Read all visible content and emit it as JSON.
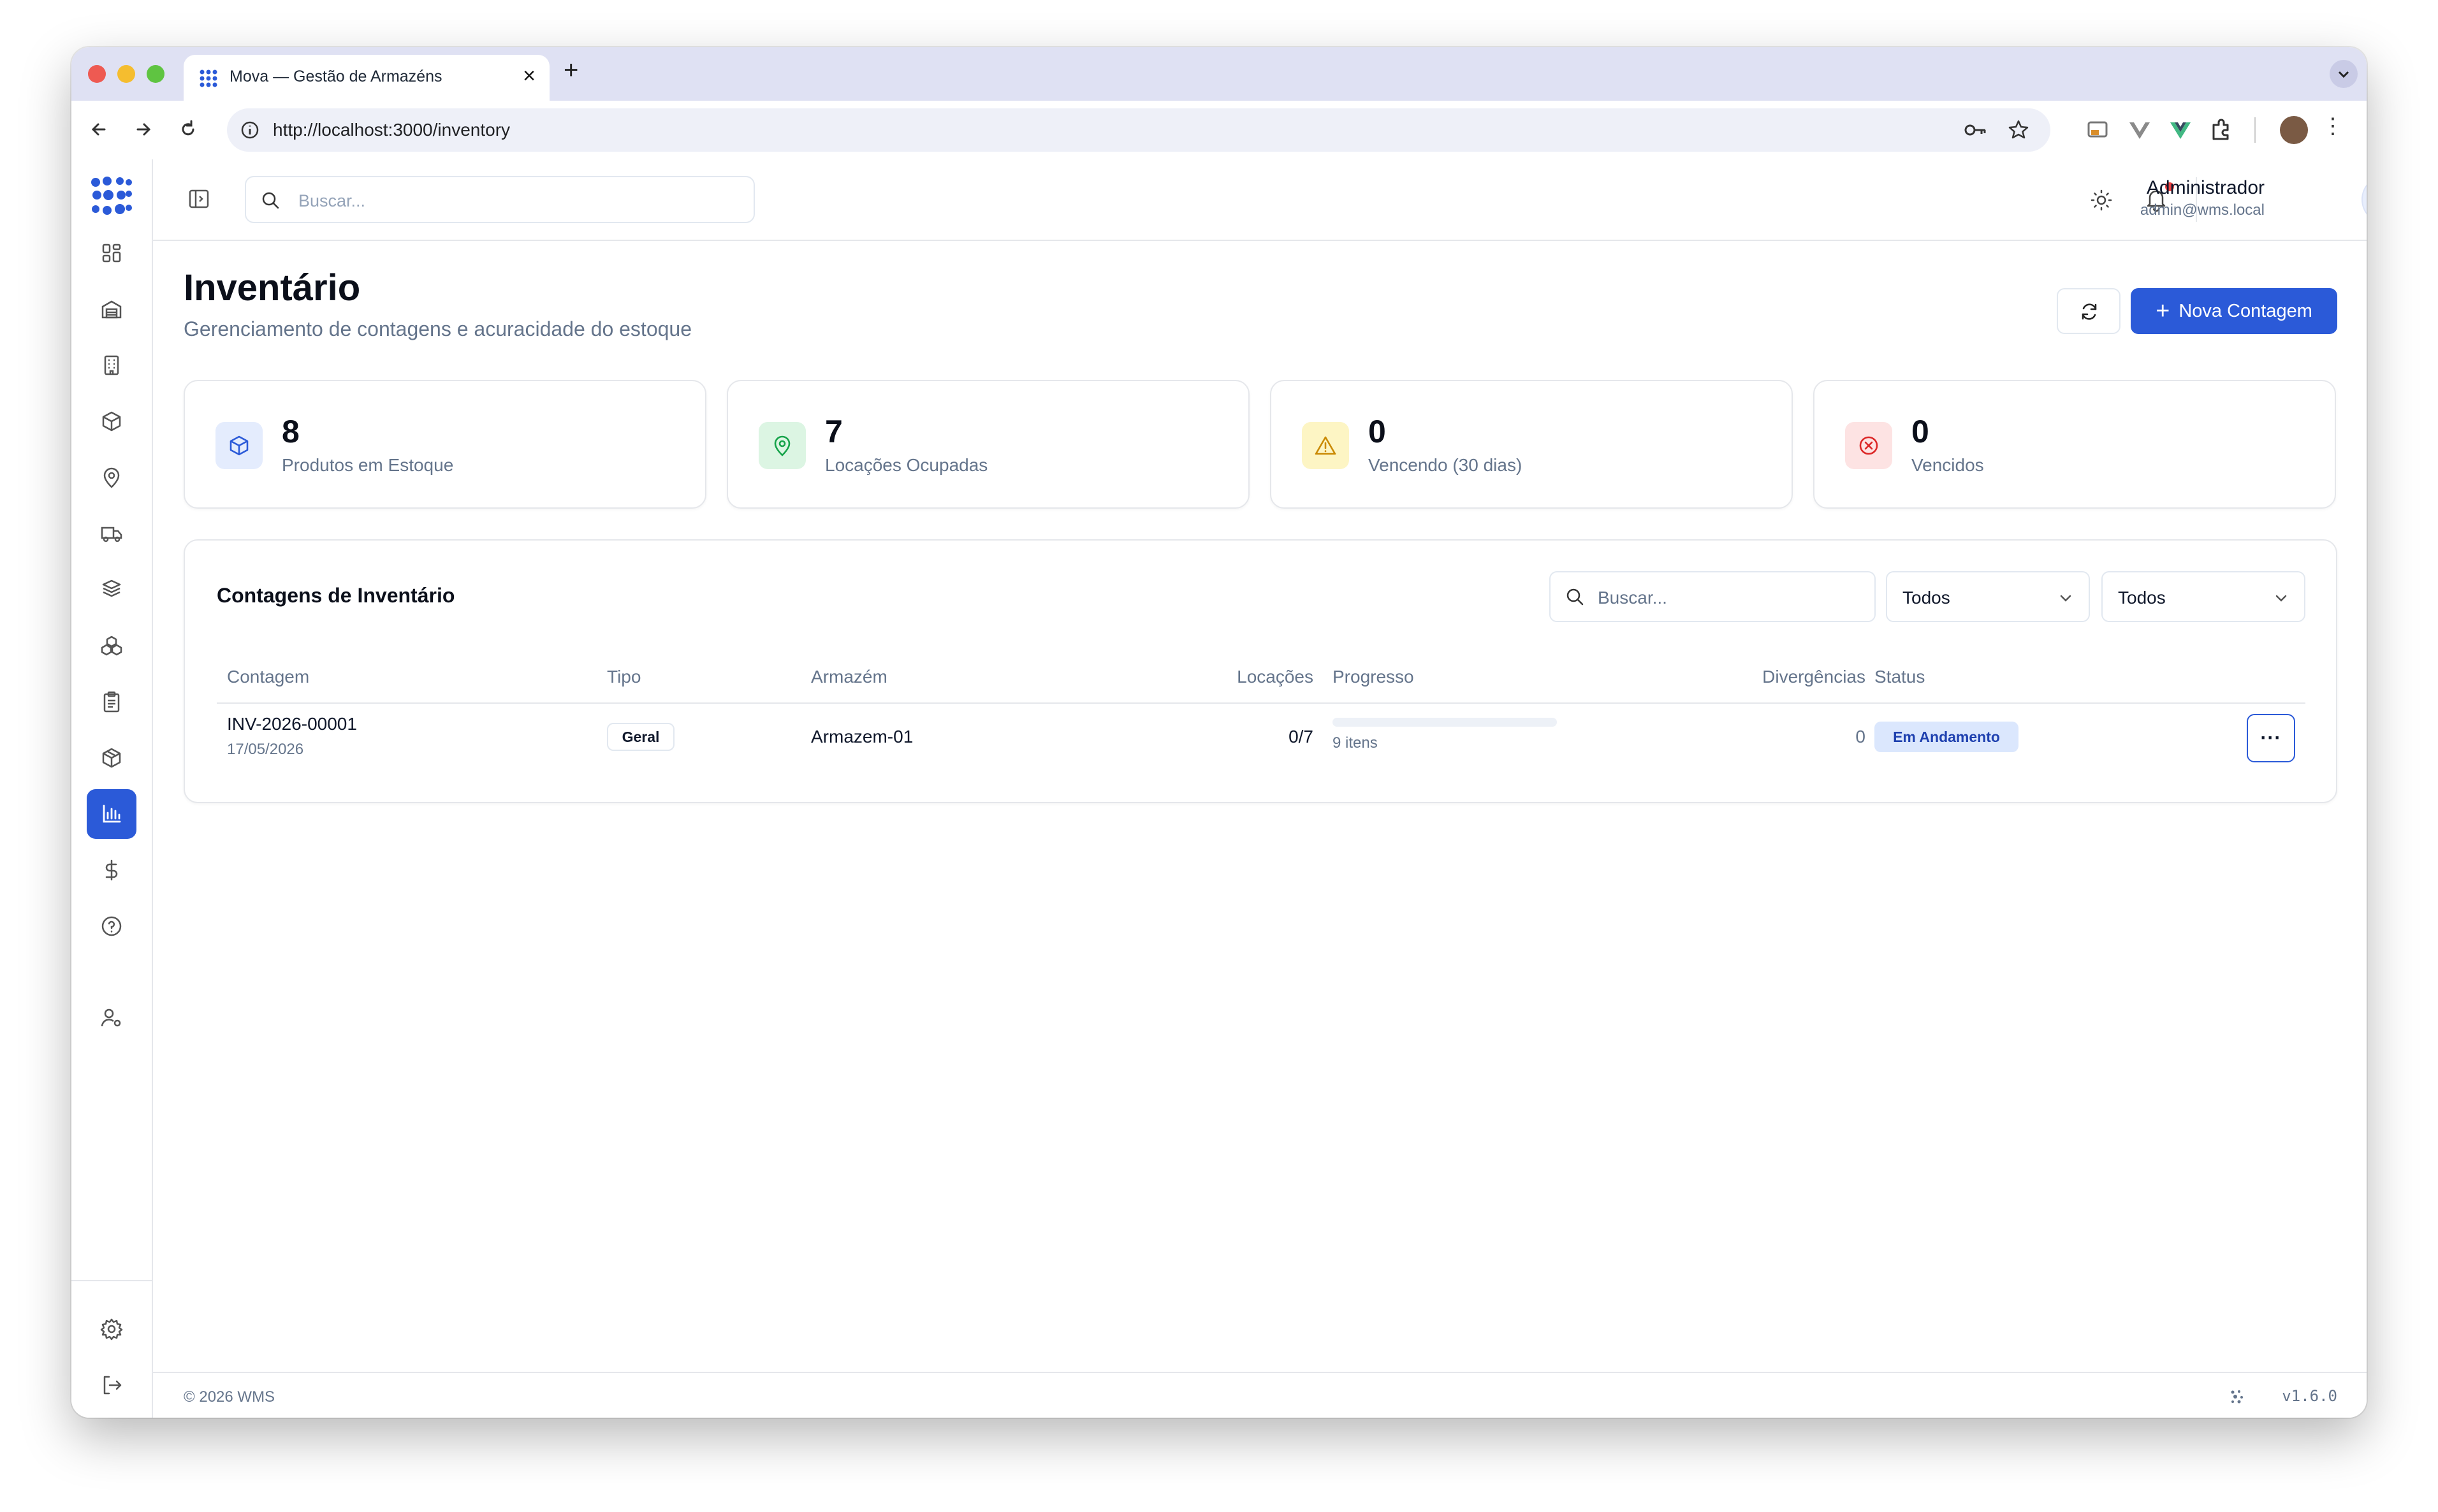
{
  "browser": {
    "tab_title": "Mova — Gestão de Armazéns",
    "url": "http://localhost:3000/inventory"
  },
  "topbar": {
    "search_placeholder": "Buscar...",
    "user_name": "Administrador",
    "user_email": "admin@wms.local"
  },
  "page": {
    "title": "Inventário",
    "subtitle": "Gerenciamento de contagens e acuracidade do estoque",
    "new_button_label": "Nova Contagem"
  },
  "stats": [
    {
      "value": "8",
      "label": "Produtos em Estoque",
      "icon": "package-icon",
      "color": "#2b5ad8"
    },
    {
      "value": "7",
      "label": "Locações Ocupadas",
      "icon": "map-pin-icon",
      "color": "#16a34a"
    },
    {
      "value": "0",
      "label": "Vencendo (30 dias)",
      "icon": "warning-icon",
      "color": "#ca8a04"
    },
    {
      "value": "0",
      "label": "Vencidos",
      "icon": "x-circle-icon",
      "color": "#dc2626"
    }
  ],
  "table": {
    "title": "Contagens de Inventário",
    "search_placeholder": "Buscar...",
    "filter_1": "Todos",
    "filter_2": "Todos",
    "columns": [
      "Contagem",
      "Tipo",
      "Armazém",
      "Locações",
      "Progresso",
      "Divergências",
      "Status"
    ],
    "rows": [
      {
        "code": "INV-2026-00001",
        "date": "17/05/2026",
        "type": "Geral",
        "warehouse": "Armazem-01",
        "locations": "0/7",
        "progress": 0,
        "progress_label": "9 itens",
        "divergences": "0",
        "status": "Em Andamento"
      }
    ]
  },
  "footer": {
    "copyright": "© 2026 WMS",
    "version": "v1.6.0"
  },
  "colors": {
    "accent": "#2b5ad8",
    "status_badge_bg": "#dbe7fd"
  }
}
